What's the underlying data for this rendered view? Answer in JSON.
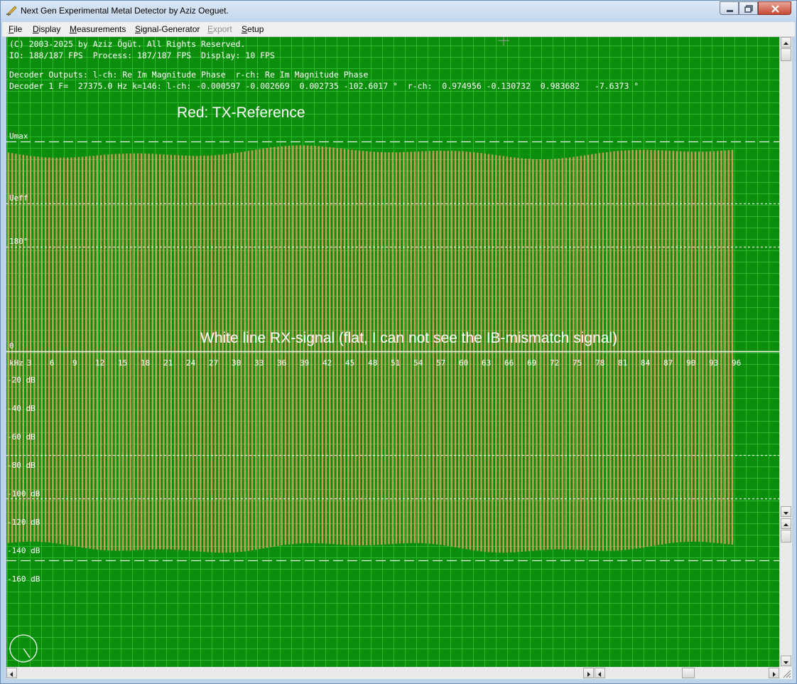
{
  "window": {
    "title": "Next Gen Experimental Metal Detector by Aziz Oeguet."
  },
  "menu": [
    "File",
    "Display",
    "Measurements",
    "Signal-Generator",
    "Export",
    "Setup"
  ],
  "menu_disabled": [
    "Export"
  ],
  "colors": {
    "scope_background": "#0b8e0b",
    "grid": "#3fd13f",
    "tx_reference": "#e8a06a",
    "text": "#ffffff"
  },
  "info": {
    "copyright": "(C) 2003-2025 by Aziz Ögüt. All Rights Reserved.",
    "fps": "IO: 188/187 FPS  Process: 187/187 FPS  Display: 10 FPS",
    "decoder_header": "Decoder Outputs: l-ch: Re Im Magnitude Phase  r-ch: Re Im Magnitude Phase",
    "decoder_line": "Decoder 1 F=  27375.0 Hz k=146: l-ch: -0.000597 -0.002669  0.002735 -102.6017 °  r-ch:  0.974956 -0.130732  0.983682   -7.6373 °"
  },
  "annotations": {
    "tx": "Red: TX-Reference",
    "rx": "White line RX-signal (flat, I can not see the IB-mismatch signal)"
  },
  "labels": {
    "umax": "Umax",
    "ueff": "Ueff",
    "deg180": "180°",
    "zero": "0",
    "khz": "kHz"
  },
  "freq_ticks": [
    "3",
    "6",
    "9",
    "12",
    "15",
    "18",
    "21",
    "24",
    "27",
    "30",
    "33",
    "36",
    "39",
    "42",
    "45",
    "48",
    "51",
    "54",
    "57",
    "60",
    "63",
    "66",
    "69",
    "72",
    "75",
    "78",
    "81",
    "84",
    "87",
    "90",
    "93",
    "96"
  ],
  "db_labels": [
    "-20 dB",
    "-40 dB",
    "-60 dB",
    "-80 dB",
    "-100 dB",
    "-120 dB",
    "-140 dB",
    "-160 dB"
  ]
}
